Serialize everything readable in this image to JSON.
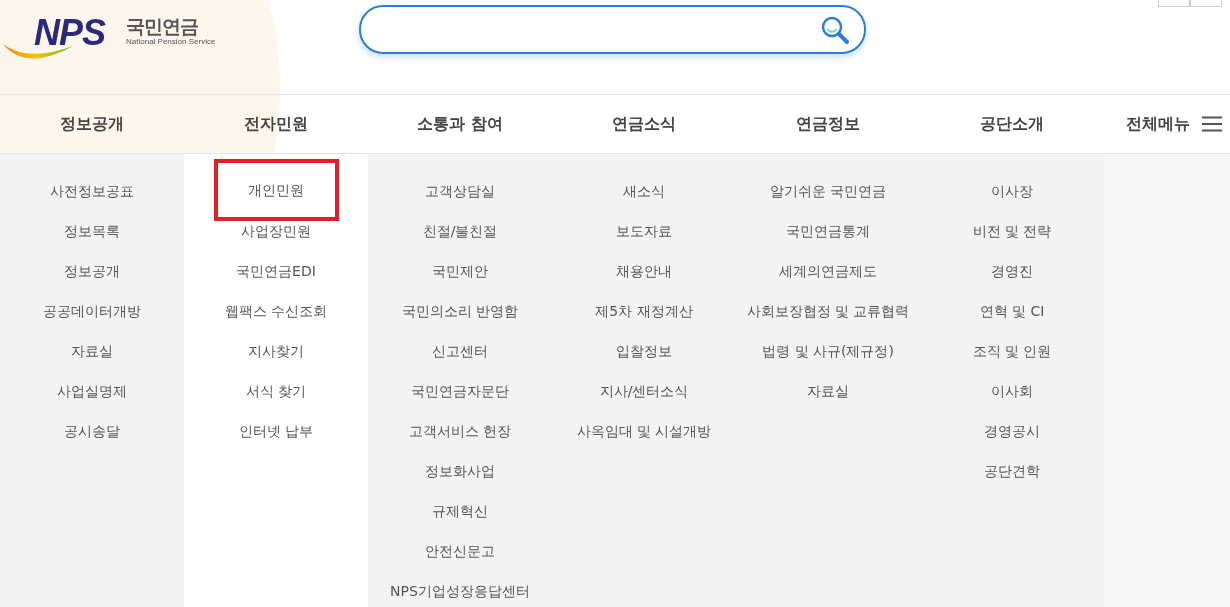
{
  "logo": {
    "mark": "NPS",
    "name": "국민연금",
    "subtitle": "National Pension Service"
  },
  "all_menu": {
    "label": "전체메뉴"
  },
  "menus": [
    {
      "label": "정보공개",
      "highlighted": false,
      "items": [
        {
          "label": "사전정보공표",
          "selected": false
        },
        {
          "label": "정보목록",
          "selected": false
        },
        {
          "label": "정보공개",
          "selected": false
        },
        {
          "label": "공공데이터개방",
          "selected": false
        },
        {
          "label": "자료실",
          "selected": false
        },
        {
          "label": "사업실명제",
          "selected": false
        },
        {
          "label": "공시송달",
          "selected": false
        }
      ]
    },
    {
      "label": "전자민원",
      "highlighted": true,
      "items": [
        {
          "label": "개인민원",
          "selected": true
        },
        {
          "label": "사업장민원",
          "selected": false
        },
        {
          "label": "국민연금EDI",
          "selected": false
        },
        {
          "label": "웹팩스 수신조회",
          "selected": false
        },
        {
          "label": "지사찾기",
          "selected": false
        },
        {
          "label": "서식 찾기",
          "selected": false
        },
        {
          "label": "인터넷 납부",
          "selected": false
        }
      ]
    },
    {
      "label": "소통과 참여",
      "highlighted": false,
      "items": [
        {
          "label": "고객상담실",
          "selected": false
        },
        {
          "label": "친절/불친절",
          "selected": false
        },
        {
          "label": "국민제안",
          "selected": false
        },
        {
          "label": "국민의소리 반영함",
          "selected": false
        },
        {
          "label": "신고센터",
          "selected": false
        },
        {
          "label": "국민연금자문단",
          "selected": false
        },
        {
          "label": "고객서비스 헌장",
          "selected": false
        },
        {
          "label": "정보화사업",
          "selected": false
        },
        {
          "label": "규제혁신",
          "selected": false
        },
        {
          "label": "안전신문고",
          "selected": false
        },
        {
          "label": "NPS기업성장응답센터",
          "selected": false
        }
      ]
    },
    {
      "label": "연금소식",
      "highlighted": false,
      "items": [
        {
          "label": "새소식",
          "selected": false
        },
        {
          "label": "보도자료",
          "selected": false
        },
        {
          "label": "채용안내",
          "selected": false
        },
        {
          "label": "제5차 재정계산",
          "selected": false
        },
        {
          "label": "입찰정보",
          "selected": false
        },
        {
          "label": "지사/센터소식",
          "selected": false
        },
        {
          "label": "사옥임대 및 시설개방",
          "selected": false
        }
      ]
    },
    {
      "label": "연금정보",
      "highlighted": false,
      "items": [
        {
          "label": "알기쉬운 국민연금",
          "selected": false
        },
        {
          "label": "국민연금통계",
          "selected": false
        },
        {
          "label": "세계의연금제도",
          "selected": false
        },
        {
          "label": "사회보장협정 및 교류협력",
          "selected": false
        },
        {
          "label": "법령 및 사규(제규정)",
          "selected": false
        },
        {
          "label": "자료실",
          "selected": false
        }
      ]
    },
    {
      "label": "공단소개",
      "highlighted": false,
      "items": [
        {
          "label": "이사장",
          "selected": false
        },
        {
          "label": "비전 및 전략",
          "selected": false
        },
        {
          "label": "경영진",
          "selected": false
        },
        {
          "label": "연혁 및 CI",
          "selected": false
        },
        {
          "label": "조직 및 인원",
          "selected": false
        },
        {
          "label": "이사회",
          "selected": false
        },
        {
          "label": "경영공시",
          "selected": false
        },
        {
          "label": "공단견학",
          "selected": false
        }
      ]
    }
  ]
}
